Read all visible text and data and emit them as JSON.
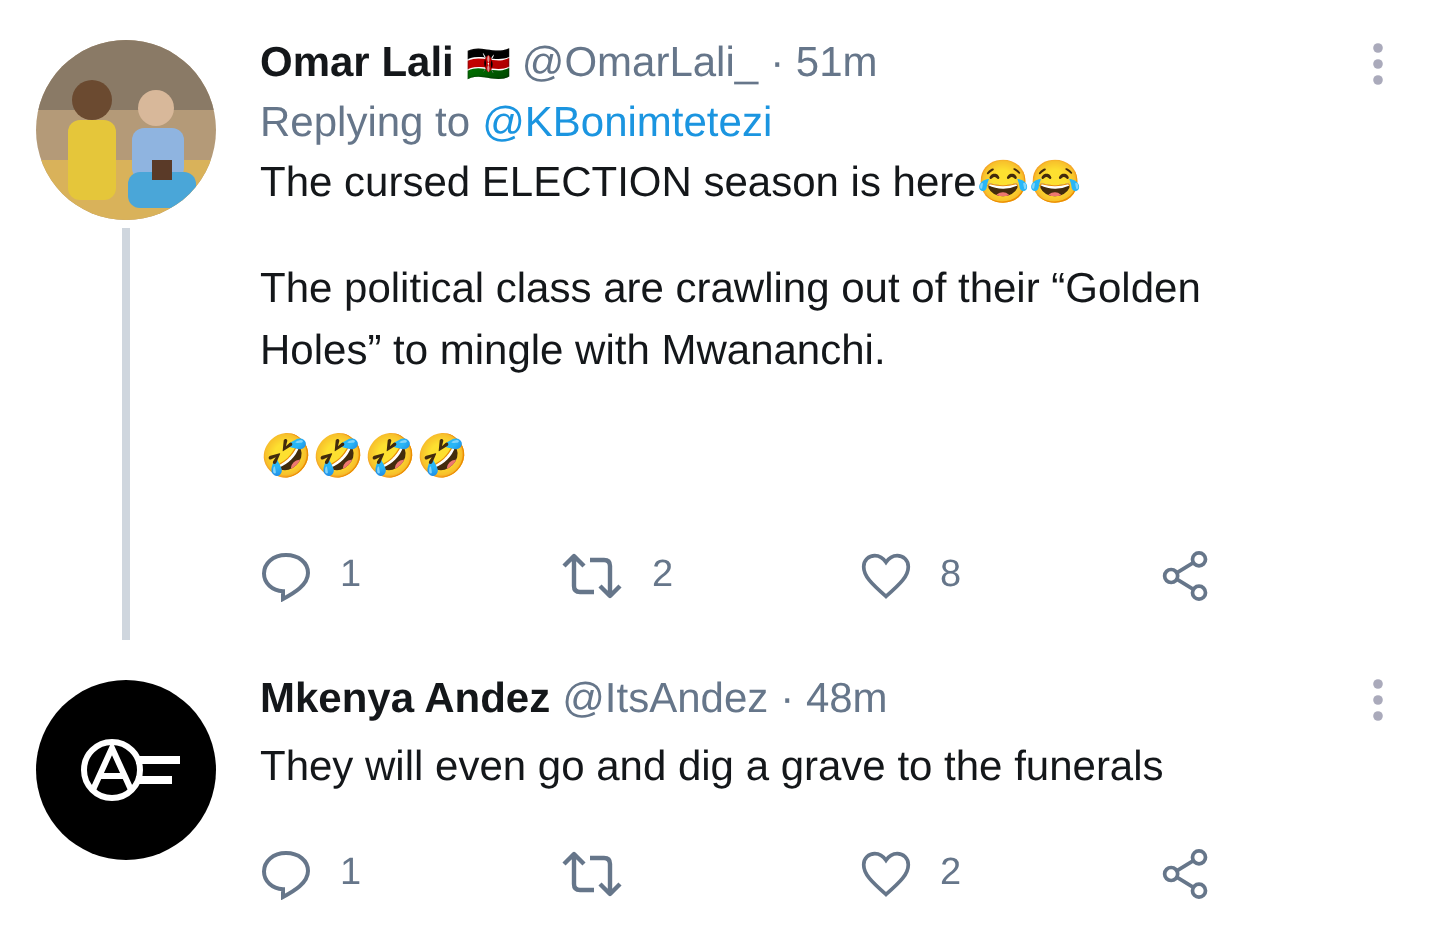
{
  "tweets": [
    {
      "name": "Omar Lali",
      "flag": "🇰🇪",
      "handle": "@OmarLali_",
      "time": "· 51m",
      "reply_prefix": "Replying to",
      "reply_to": "@KBonimtetezi",
      "paragraphs": [
        "The cursed ELECTION season is here😂😂",
        "The political class are crawling out of their “Golden Holes” to mingle with Mwananchi.",
        "🤣🤣🤣🤣"
      ],
      "replies": "1",
      "retweets": "2",
      "likes": "8",
      "thread_line": true
    },
    {
      "avatar": {
        "kind": "logo"
      },
      "name": "Mkenya Andez",
      "handle": "@ItsAndez",
      "time": "· 48m",
      "paragraphs": [
        "They will even go and dig a grave to the funerals"
      ],
      "replies": "1",
      "likes": "2",
      "thread_line": false
    }
  ]
}
